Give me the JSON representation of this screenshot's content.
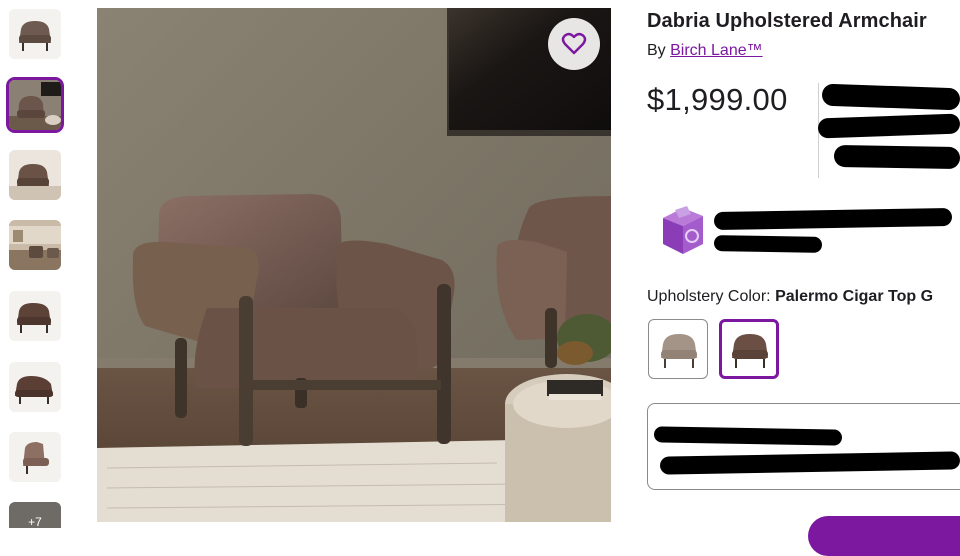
{
  "gallery": {
    "more_label": "+7",
    "selected_index": 1
  },
  "product": {
    "title": "Dabria Upholstered Armchair",
    "by_prefix": "By",
    "brand": "Birch Lane™",
    "price": "$1,999.00"
  },
  "options": {
    "label": "Upholstery Color:",
    "selected_value": "Palermo Cigar Top G",
    "swatch_count": 2,
    "selected_swatch": 1
  },
  "colors": {
    "accent": "#7b189f",
    "text": "#1f1d21"
  },
  "icons": {
    "favorite": "heart-outline-icon",
    "registry": "gift-box-icon"
  }
}
